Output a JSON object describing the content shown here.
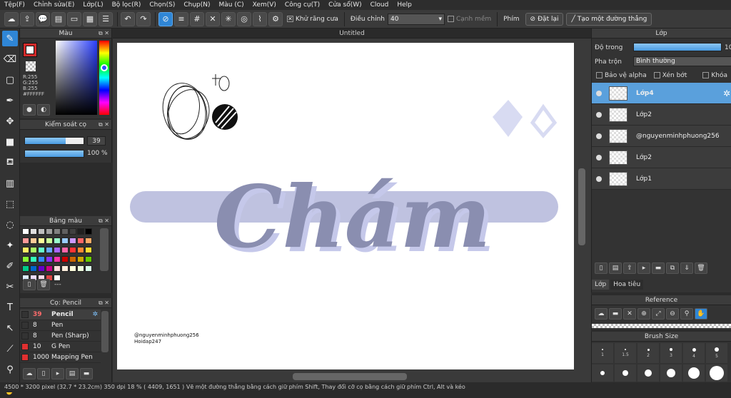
{
  "menu": [
    "Tệp(F)",
    "Chỉnh sửa(E)",
    "Lớp(L)",
    "Bộ lọc(R)",
    "Chọn(S)",
    "Chụp(N)",
    "Màu (C)",
    "Xem(V)",
    "Công cụ(T)",
    "Cửa sổ(W)",
    "Cloud",
    "Help"
  ],
  "toolbar": {
    "antialias_label": "Khử răng cưa",
    "adjust_label": "Điều chỉnh",
    "adjust_value": "40",
    "edge_label": "Cạnh mềm",
    "key_label": "Phím",
    "reset_label": "Đặt lại",
    "line_label": "Tạo một đường thẳng"
  },
  "color_panel": {
    "title": "Màu",
    "r": "R:255",
    "g": "G:255",
    "b": "B:255",
    "hex": "#FFFFFF",
    "primary": "#ffffff",
    "secondary": "#d22b2b"
  },
  "brush_control": {
    "title": "Kiểm soát cọ",
    "size": "39",
    "opacity": "100 %",
    "size_fraction": 0.7,
    "opacity_fraction": 1.0
  },
  "palette": {
    "title": "Bảng màu",
    "dash": "---",
    "colors": [
      "#ffffff",
      "#e0e0e0",
      "#c0c0c0",
      "#a0a0a0",
      "#808080",
      "#606060",
      "#404040",
      "#202020",
      "#000000",
      "#ff9999",
      "#ffcc99",
      "#ffff99",
      "#ccff99",
      "#99ffcc",
      "#99ccff",
      "#cc99ff",
      "#ff6666",
      "#ffaa66",
      "#ffee66",
      "#aaff66",
      "#66ffcc",
      "#66aaff",
      "#aa66ff",
      "#ff66aa",
      "#ff3333",
      "#ff8833",
      "#ffdd33",
      "#88ff33",
      "#33ffbb",
      "#3388ff",
      "#8833ff",
      "#ff33aa",
      "#cc0000",
      "#cc6600",
      "#ccaa00",
      "#66cc00",
      "#00cc88",
      "#0066cc",
      "#6600cc",
      "#cc0088",
      "#ffdddd",
      "#ffeedd",
      "#ffffdd",
      "#eeffdd",
      "#ddffee",
      "#ddeeff",
      "#eeddff",
      "#ffddee",
      "#dd4444",
      "#ffffff"
    ]
  },
  "brush_list": {
    "title": "Cọ: Pencil",
    "items": [
      {
        "size": "39",
        "name": "Pencil",
        "color": "#333333"
      },
      {
        "size": "8",
        "name": "Pen",
        "color": "#333333"
      },
      {
        "size": "8",
        "name": "Pen (Sharp)",
        "color": "#333333"
      },
      {
        "size": "10",
        "name": "G Pen",
        "color": "#e03030"
      },
      {
        "size": "1000",
        "name": "Mapping Pen",
        "color": "#e03030"
      }
    ]
  },
  "document": {
    "tab": "Untitled",
    "watermark_line1": "@nguyenminhphuong256",
    "watermark_line2": "Hoidap247",
    "artwork_text": "Chám"
  },
  "layers_panel": {
    "title": "Lớp",
    "opacity_label": "Độ trong",
    "opacity_value": "10",
    "opacity_fraction": 1.0,
    "blend_label": "Pha trộn",
    "blend_value": "Bình thường",
    "protect_alpha": "Bảo vệ alpha",
    "clipping": "Xén bớt",
    "lock": "Khóa",
    "layers": [
      {
        "name": "Lớp4",
        "active": true
      },
      {
        "name": "Lớp2",
        "active": false
      },
      {
        "name": "@nguyenminhphuong256",
        "active": false
      },
      {
        "name": "Lớp2",
        "active": false
      },
      {
        "name": "Lớp1",
        "active": false
      }
    ],
    "tabs": [
      "Lớp",
      "Hoa tiêu"
    ]
  },
  "reference": {
    "title": "Reference"
  },
  "brush_size": {
    "title": "Brush Size",
    "row1": [
      "1",
      "1.5",
      "2",
      "3",
      "4",
      "5"
    ]
  },
  "status": {
    "dimensions": "4500 * 3200 pixel",
    "size_cm": "(32.7 * 23.2cm)",
    "dpi": "350 dpi",
    "zoom": "18 %",
    "coords": "( 4409, 1651 )",
    "hint": "Vẽ một đường thẳng bằng cách giữ phím Shift, Thay đổi cỡ cọ bằng cách giữ phím Ctrl, Alt và kéo"
  }
}
